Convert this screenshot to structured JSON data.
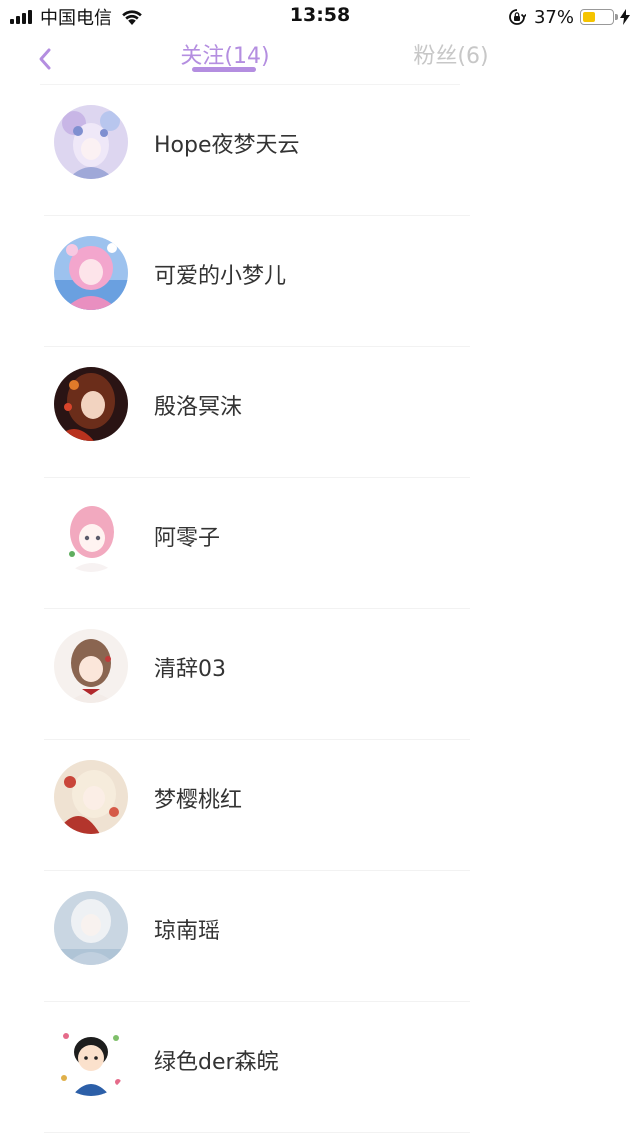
{
  "status_bar": {
    "carrier": "中国电信",
    "time": "13:58",
    "battery_percent": "37%",
    "battery_level": 0.37,
    "battery_color": "#f5c400"
  },
  "nav": {
    "back_icon": "chevron-left-icon",
    "tabs": [
      {
        "label": "关注(14)",
        "active": true
      },
      {
        "label": "粉丝(6)",
        "active": false
      }
    ],
    "accent_color": "#b48ee0",
    "inactive_color": "#c7c7c7"
  },
  "following": [
    {
      "name": "Hope夜梦天云",
      "avatar": "anime-avatar-lilac"
    },
    {
      "name": "可爱的小梦儿",
      "avatar": "anime-avatar-pink-blue"
    },
    {
      "name": "殷洛冥沫",
      "avatar": "anime-avatar-dark-red"
    },
    {
      "name": "阿零子",
      "avatar": "anime-avatar-pink-hair"
    },
    {
      "name": "清辞03",
      "avatar": "anime-avatar-brown-hair"
    },
    {
      "name": "梦樱桃红",
      "avatar": "anime-avatar-red-cream"
    },
    {
      "name": "琼南瑶",
      "avatar": "anime-avatar-pale-blue"
    },
    {
      "name": "绿色der森皖",
      "avatar": "cartoon-avatar-boy"
    }
  ]
}
